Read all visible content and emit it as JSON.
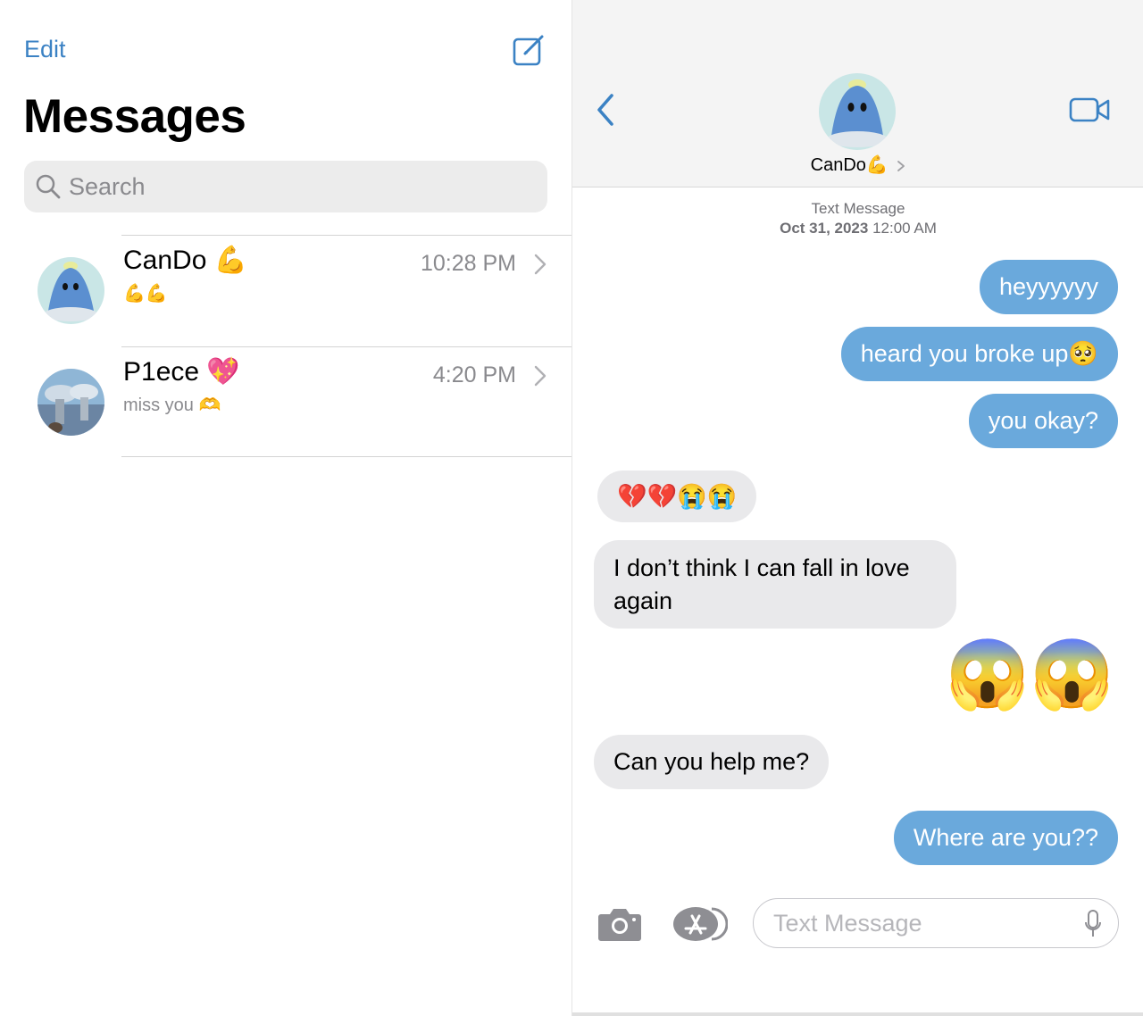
{
  "list": {
    "edit_label": "Edit",
    "title": "Messages",
    "search_placeholder": "Search",
    "conversations": [
      {
        "name": "CanDo 💪",
        "preview": "💪💪",
        "time": "10:28 PM"
      },
      {
        "name": "P1ece 💖",
        "preview": "miss you 🫶",
        "time": "4:20 PM"
      }
    ]
  },
  "chat": {
    "contact_name": "CanDo💪",
    "meta_label": "Text Message",
    "meta_date": "Oct 31, 2023",
    "meta_time": "12:00 AM",
    "messages": [
      {
        "dir": "out",
        "text": "heyyyyyy"
      },
      {
        "dir": "out",
        "text": "heard you broke up🥺"
      },
      {
        "dir": "out",
        "text": "you okay?"
      },
      {
        "dir": "in",
        "text": "💔💔😭😭"
      },
      {
        "dir": "in",
        "line1": "I don’t think I can fall in love",
        "line2": "again"
      },
      {
        "dir": "out",
        "text": "😱😱"
      },
      {
        "dir": "in",
        "text": "Can you help me?"
      },
      {
        "dir": "out",
        "text": "Where are you??"
      }
    ],
    "input_placeholder": "Text Message"
  },
  "colors": {
    "accent": "#3b82c4",
    "outgoing_bubble": "#6aa9dc",
    "incoming_bubble": "#e9e9eb"
  },
  "icons": [
    "compose-icon",
    "search-icon",
    "chevron-right-icon",
    "back-chevron-icon",
    "video-camera-icon",
    "camera-icon",
    "app-store-icon",
    "microphone-icon"
  ]
}
